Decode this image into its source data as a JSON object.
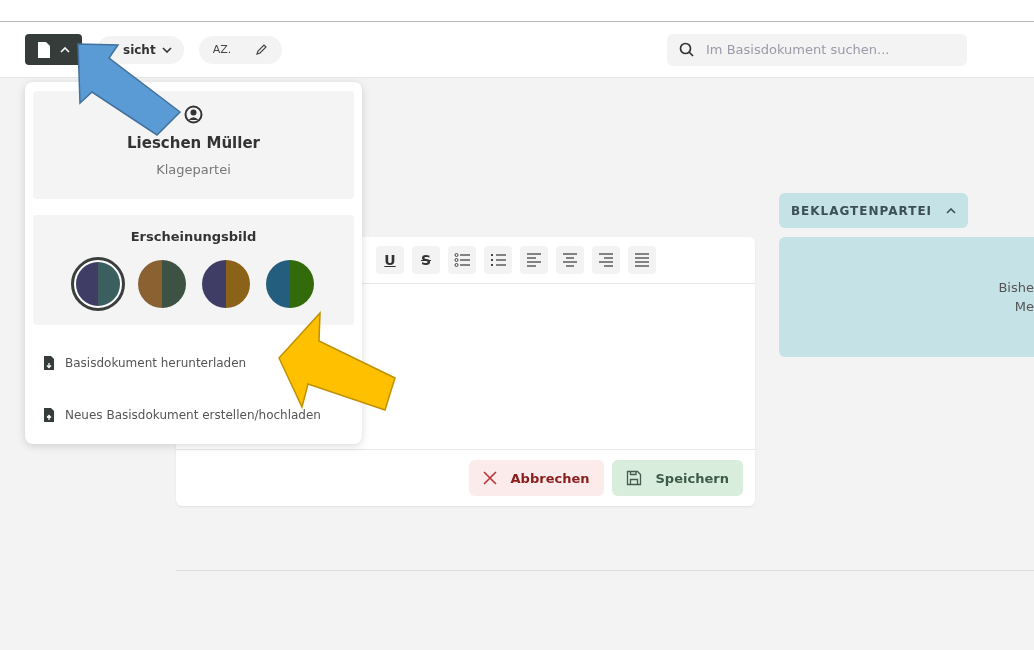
{
  "toolbar": {
    "document_menu": {
      "expanded": true
    },
    "view_button": {
      "label": "sicht"
    },
    "case_number": {
      "label": "AZ."
    },
    "search": {
      "placeholder": "Im Basisdokument suchen..."
    }
  },
  "menu": {
    "user": {
      "name": "Lieschen Müller",
      "role": "Klagepartei"
    },
    "appearance": {
      "title": "Erscheinungsbild",
      "themes": [
        {
          "halves": [
            {
              "color": "#3f3d66"
            },
            {
              "color": "#3b5f5f"
            }
          ],
          "selected": true
        },
        {
          "halves": [
            {
              "color": "#8a6232"
            },
            {
              "color": "#3e5244"
            }
          ],
          "selected": false
        },
        {
          "halves": [
            {
              "color": "#3f3d66"
            },
            {
              "color": "#8a6318"
            }
          ],
          "selected": false
        },
        {
          "halves": [
            {
              "color": "#235e7e"
            },
            {
              "color": "#336b0c"
            }
          ],
          "selected": false
        }
      ]
    },
    "actions": [
      {
        "kind": "download",
        "label": "Basisdokument herunterladen"
      },
      {
        "kind": "upload",
        "label": "Neues Basisdokument erstellen/hochladen"
      }
    ]
  },
  "editor": {
    "format_buttons": [
      {
        "kind": "underline",
        "label": "U"
      },
      {
        "kind": "strike",
        "label": "S"
      },
      {
        "kind": "bullets"
      },
      {
        "kind": "numbers"
      },
      {
        "kind": "left"
      },
      {
        "kind": "center"
      },
      {
        "kind": "right"
      },
      {
        "kind": "justify"
      }
    ],
    "cancel": "Abbrechen",
    "save": "Speichern"
  },
  "party": {
    "title": "BEKLAGTENPARTEI",
    "expanded": true,
    "lines": [
      "Bishe",
      "Me"
    ]
  }
}
